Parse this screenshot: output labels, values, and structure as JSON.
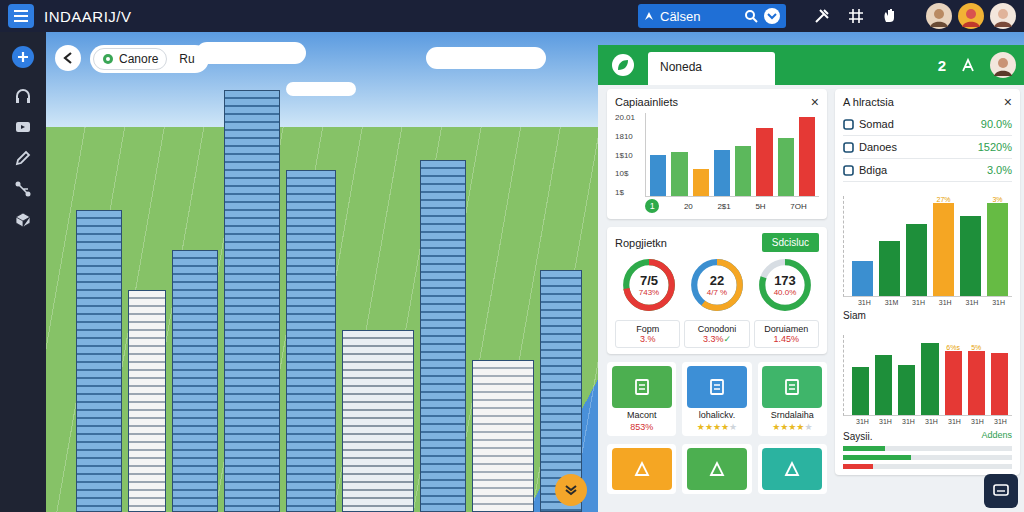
{
  "app": {
    "title": "INDAARIJ/V"
  },
  "search": {
    "value": "Cälsen"
  },
  "map": {
    "chip_label": "Canore",
    "secondary_label": "Ru"
  },
  "panel": {
    "tab": "Noneda",
    "count": "2"
  },
  "capital_card": {
    "title": "Capiaainliets",
    "close": "×",
    "max": 20,
    "y_ticks": [
      "20.01",
      "1810",
      "1$10",
      "10$",
      "1$"
    ],
    "badge": "1",
    "x_labels": [
      "20",
      "2$1",
      "5H",
      "7OH"
    ],
    "bars": [
      {
        "value": 10,
        "color": "#3b8fd0"
      },
      {
        "value": 10.5,
        "color": "#5cb85c"
      },
      {
        "value": 6.5,
        "color": "#f5a623"
      },
      {
        "value": 11,
        "color": "#3b8fd0"
      },
      {
        "value": 12,
        "color": "#5cb85c"
      },
      {
        "value": 16.5,
        "color": "#e53935"
      },
      {
        "value": 14,
        "color": "#5cb85c"
      },
      {
        "value": 19,
        "color": "#e53935"
      }
    ]
  },
  "progress_card": {
    "title": "Ropgjietkn",
    "button": "Sdcisluc",
    "gauges": [
      {
        "value": "7/5",
        "percent": "743%",
        "level": 0.72,
        "color": "#e53935",
        "track": "#2eaa4a",
        "label": "Fopm",
        "delta": "3.%"
      },
      {
        "value": "22",
        "percent": "4/7 %",
        "level": 0.6,
        "color": "#f5a623",
        "track": "#3b8fd0",
        "label": "Conodoni",
        "delta": "3.3%",
        "mark": "✓"
      },
      {
        "value": "173",
        "percent": "40.0%",
        "level": 0.8,
        "color": "#2eaa4a",
        "track": "#d7dde3",
        "label": "Doruiamen",
        "delta": "1.45%"
      }
    ]
  },
  "tiles": {
    "star_char": "★",
    "items": [
      {
        "kind": "value",
        "label": "Macont",
        "value": "853%",
        "color": "#4caf50"
      },
      {
        "kind": "stars",
        "label": "lohalickv.",
        "stars": 4,
        "color": "#3d8fd6"
      },
      {
        "kind": "stars",
        "label": "Srndalaiha",
        "stars": 4,
        "color": "#3fb56a"
      }
    ],
    "second_row": [
      {
        "color": "#f5a623"
      },
      {
        "color": "#4caf50"
      },
      {
        "color": "#2bb3a0"
      }
    ]
  },
  "stats_card": {
    "title": "A hlractsia",
    "close": "×",
    "rows": [
      {
        "label": "Somad",
        "value": "90.0%"
      },
      {
        "label": "Danoes",
        "value": "1520%"
      },
      {
        "label": "Bdiga",
        "value": "3.0%"
      }
    ]
  },
  "chart_a": {
    "max": 100,
    "x_labels": [
      "31H",
      "31M",
      "31H",
      "31H",
      "31H",
      "31H"
    ],
    "bars": [
      {
        "value": 35,
        "color": "#3b8fd0"
      },
      {
        "value": 55,
        "color": "#1e8f3a"
      },
      {
        "value": 72,
        "color": "#1e8f3a"
      },
      {
        "value": 95,
        "color": "#f5a623",
        "tag": "27%"
      },
      {
        "value": 80,
        "color": "#1e8f3a"
      },
      {
        "value": 98,
        "color": "#66bb44",
        "tag": "3%"
      }
    ]
  },
  "chart_b": {
    "title": "Siam",
    "max": 100,
    "x_labels": [
      "31H",
      "31H",
      "31H",
      "31H",
      "31H",
      "31H",
      "31H"
    ],
    "bars": [
      {
        "value": 60,
        "color": "#1e8f3a"
      },
      {
        "value": 75,
        "color": "#1e8f3a"
      },
      {
        "value": 62,
        "color": "#1e8f3a"
      },
      {
        "value": 90,
        "color": "#1e8f3a"
      },
      {
        "value": 80,
        "color": "#e53935",
        "tag": "6%s"
      },
      {
        "value": 80,
        "color": "#e53935",
        "tag": "5%"
      },
      {
        "value": 78,
        "color": "#e53935"
      }
    ]
  },
  "chart_c": {
    "title": "Saysii.",
    "action": "Addens",
    "rows": [
      {
        "level": 0.25,
        "color": "#2eaa4a"
      },
      {
        "level": 0.4,
        "color": "#2eaa4a"
      },
      {
        "level": 0.18,
        "color": "#e53935"
      }
    ]
  }
}
